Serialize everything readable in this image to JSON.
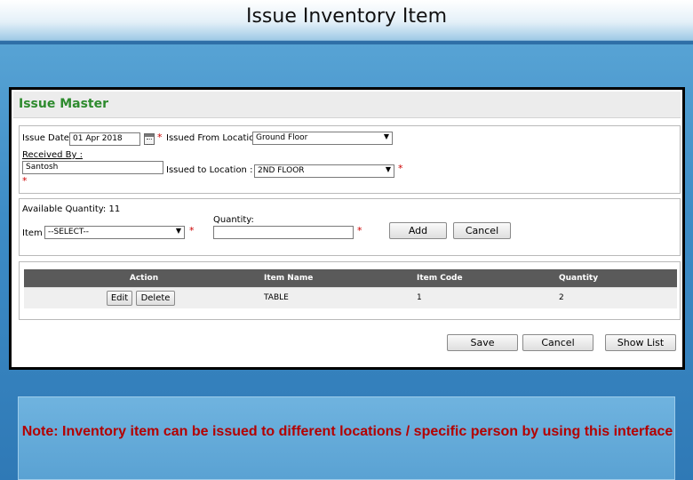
{
  "slide": {
    "title": "Issue Inventory Item",
    "note": "Note: Inventory item can be issued to different locations / specific person by using this interface"
  },
  "form": {
    "header": "Issue Master",
    "issue_date_label": "Issue Date :",
    "issue_date_value": "01 Apr 2018",
    "issued_from_label": "Issued From Location:",
    "issued_from_value": "Ground Floor",
    "received_by_label": "Received By :",
    "received_by_value": "Santosh",
    "issued_to_label": "Issued to Location :",
    "issued_to_value": "2ND FLOOR",
    "required_mark": "*",
    "available_qty_label": "Available Quantity: 11",
    "item_label": "Item :",
    "item_value": "--SELECT--",
    "quantity_label": "Quantity:",
    "quantity_value": "",
    "add_label": "Add",
    "cancel_label": "Cancel",
    "table": {
      "headers": [
        "Action",
        "Item Name",
        "Item Code",
        "Quantity"
      ],
      "rows": [
        {
          "edit": "Edit",
          "delete": "Delete",
          "item_name": "TABLE",
          "item_code": "1",
          "quantity": "2"
        }
      ]
    },
    "save_label": "Save",
    "cancel_bottom_label": "Cancel",
    "show_list_label": "Show List"
  },
  "colors": {
    "header_green": "#2e8b2e",
    "required_red": "#cc0000",
    "note_red": "#b30000",
    "grid_header": "#5a5a5a"
  }
}
